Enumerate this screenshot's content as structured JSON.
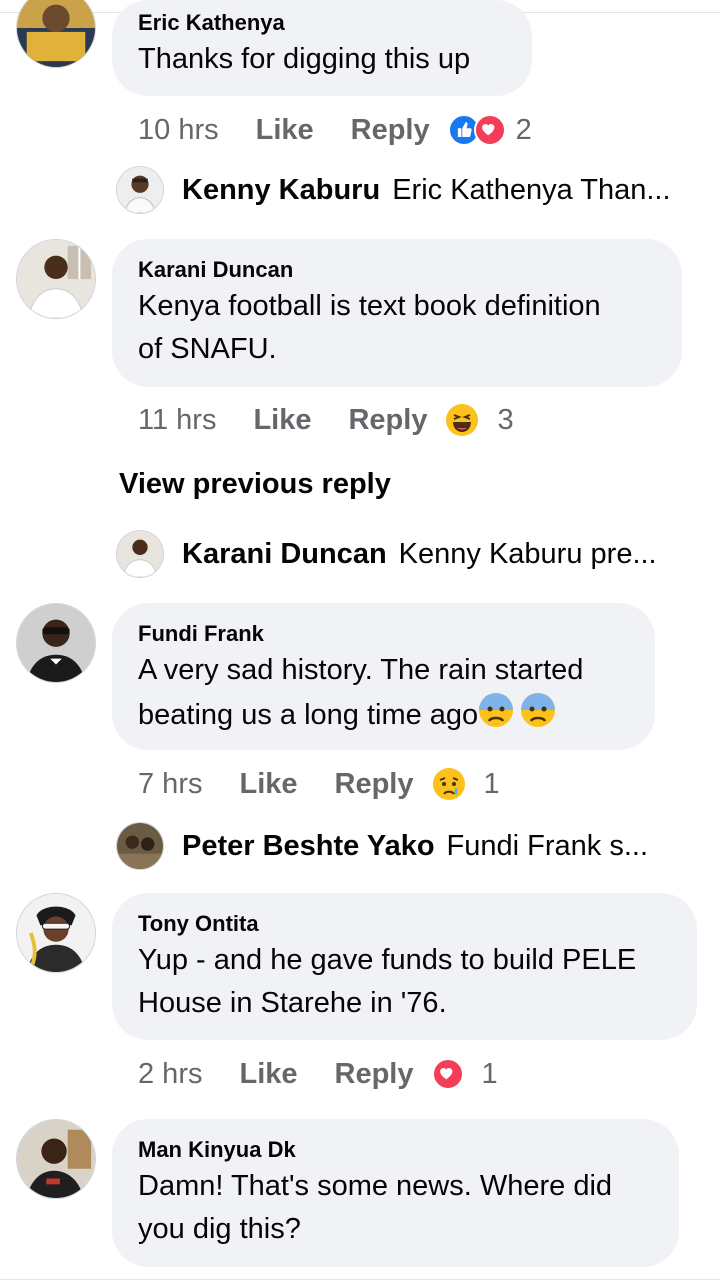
{
  "comments": [
    {
      "name": "Eric Kathenya",
      "text": "Thanks for digging this up",
      "time": "10 hrs",
      "like": "Like",
      "reply": "Reply",
      "reaction_count": "2"
    },
    {
      "name": "Karani Duncan",
      "text_lines": [
        "Kenya football is text book definition",
        "of SNAFU."
      ],
      "time": "11 hrs",
      "like": "Like",
      "reply": "Reply",
      "reaction_count": "3"
    },
    {
      "name": "Fundi Frank",
      "text_lines": [
        "A very sad history. The rain started",
        "beating us a long time ago"
      ],
      "time": "7 hrs",
      "like": "Like",
      "reply": "Reply",
      "reaction_count": "1"
    },
    {
      "name": "Tony Ontita",
      "text_lines": [
        "Yup - and he gave funds to build PELE",
        "House in Starehe in '76."
      ],
      "time": "2 hrs",
      "like": "Like",
      "reply": "Reply",
      "reaction_count": "1"
    },
    {
      "name": "Man Kinyua Dk",
      "text_lines": [
        "Damn! That's some news. Where did",
        "you dig this?"
      ]
    }
  ],
  "replies": [
    {
      "name": "Kenny Kaburu",
      "preview": "Eric Kathenya Than..."
    },
    {
      "name": "Karani Duncan",
      "preview": "Kenny Kaburu pre..."
    },
    {
      "name": "Peter Beshte Yako",
      "preview": "Fundi Frank s..."
    }
  ],
  "view_previous": "View previous reply",
  "reactions": {
    "c1": [
      "like",
      "love"
    ],
    "c2": [
      "laughing"
    ],
    "c3": [
      "anxious"
    ],
    "c4": [
      "crying"
    ],
    "c5": [
      "love"
    ]
  },
  "colors": {
    "bubble": "#f0f2f5",
    "meta": "#65676b",
    "like_blue": "#1877f2",
    "love_red": "#f33e58",
    "emoji_yellow": "#fcc21b"
  }
}
